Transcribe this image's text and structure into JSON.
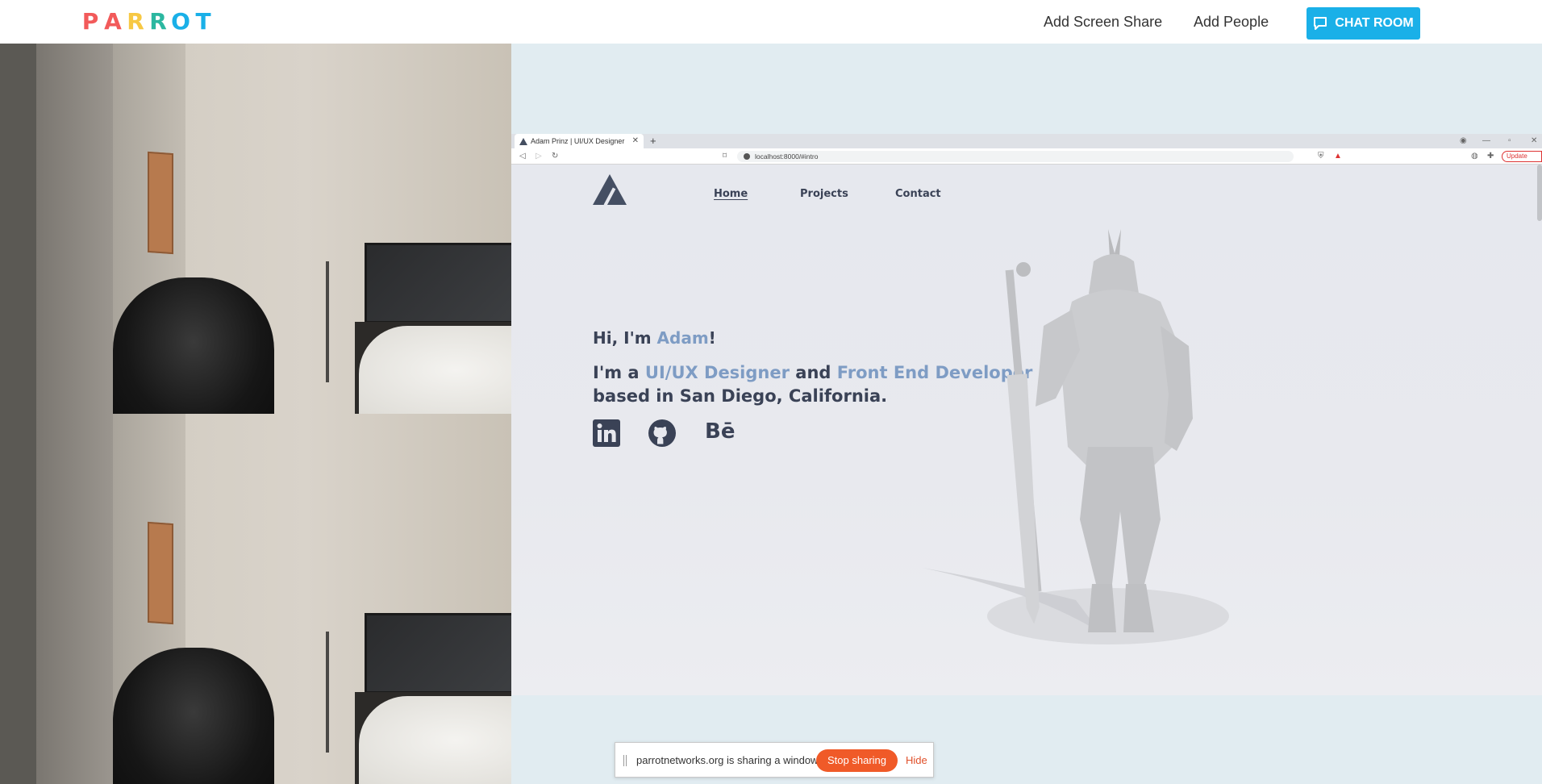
{
  "app": {
    "logo_letters": [
      "P",
      "A",
      "R",
      "R",
      "O",
      "T"
    ],
    "logo_colors": [
      "#f25a5a",
      "#f25a5a",
      "#f7c843",
      "#2bb7a0",
      "#1ab0e8",
      "#1ab0e8"
    ],
    "add_screen_share": "Add Screen Share",
    "add_people": "Add People",
    "chat_room": "CHAT ROOM",
    "accent": "#1ab0e8"
  },
  "browser": {
    "tab_title": "Adam Prinz | UI/UX Designer",
    "tab_close": "✕",
    "new_tab": "+",
    "url": "localhost:8000/#intro",
    "update": "Update"
  },
  "site": {
    "nav": [
      "Home",
      "Projects",
      "Contact"
    ],
    "greeting_pre": "Hi, I'm ",
    "greeting_name": "Adam",
    "greeting_post": "!",
    "line2_pre": "I'm a ",
    "role1": "UI/UX Designer",
    "line2_mid": " and ",
    "role2": "Front End Developer",
    "line3": "based in San Diego, California.",
    "social": [
      "linkedin-icon",
      "github-icon",
      "behance-icon"
    ],
    "behance_text": "Bē",
    "text_color": "#3a4256",
    "accent": "#7e9cc4"
  },
  "share_banner": {
    "message": "parrotnetworks.org is sharing a window.",
    "stop": "Stop sharing",
    "hide": "Hide"
  }
}
